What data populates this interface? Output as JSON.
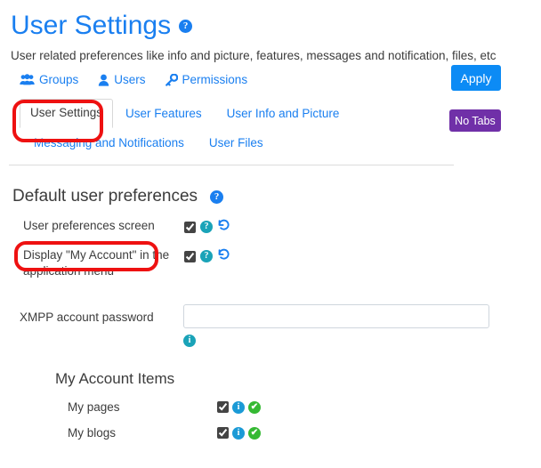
{
  "header": {
    "title": "User Settings",
    "help_icon": "help-circle-icon",
    "help_glyph": "?",
    "description": "User related preferences like info and picture, features, messages and notification, files, etc"
  },
  "nav_links": [
    {
      "label": "Groups",
      "icon": "groups-icon"
    },
    {
      "label": "Users",
      "icon": "user-icon"
    },
    {
      "label": "Permissions",
      "icon": "key-icon"
    }
  ],
  "buttons": {
    "apply": "Apply",
    "no_tabs": "No Tabs"
  },
  "tabs": {
    "row1": [
      {
        "label": "User Settings",
        "active": true
      },
      {
        "label": "User Features",
        "active": false
      },
      {
        "label": "User Info and Picture",
        "active": false
      }
    ],
    "row2": [
      {
        "label": "Messaging and Notifications",
        "active": false
      },
      {
        "label": "User Files",
        "active": false
      }
    ]
  },
  "section": {
    "title": "Default user preferences",
    "help_glyph": "?"
  },
  "preferences": [
    {
      "label": "User preferences screen",
      "checked": true,
      "help_glyph": "?",
      "reset_icon": "reset-arrow-icon"
    },
    {
      "label": "Display \"My Account\" in the application menu",
      "checked": true,
      "help_glyph": "?",
      "reset_icon": "reset-arrow-icon"
    }
  ],
  "xmpp": {
    "label": "XMPP account password",
    "value": "",
    "placeholder": "",
    "info_glyph": "i",
    "info_icon": "info-circle-icon"
  },
  "my_account_items": {
    "title": "My Account Items",
    "items": [
      {
        "label": "My pages",
        "checked": true,
        "info_glyph": "i",
        "check_glyph": "✔"
      },
      {
        "label": "My blogs",
        "checked": true,
        "info_glyph": "i",
        "check_glyph": "✔"
      }
    ]
  },
  "annotations": [
    {
      "name": "highlight-user-settings-tab",
      "color": "#ee1111"
    },
    {
      "name": "highlight-user-preferences-screen",
      "color": "#ee1111"
    }
  ],
  "colors": {
    "link_blue": "#1a7ff0",
    "apply_blue": "#0c8bf5",
    "no_tabs_purple": "#7030a8",
    "teal": "#1aa3b8",
    "green": "#35b933",
    "annotation_red": "#ee1111"
  }
}
